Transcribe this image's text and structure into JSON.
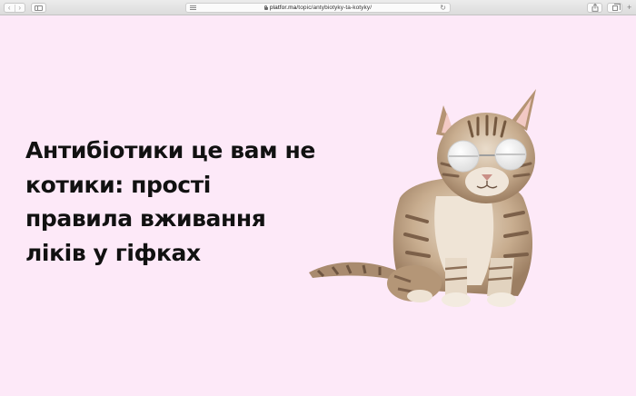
{
  "browser": {
    "url_domain": "platfor.ma",
    "url_path": "/topic/antybiotyky-ta-kotyky/",
    "icons": {
      "back": "chevron-left-icon",
      "forward": "chevron-right-icon",
      "sidebar": "sidebar-icon",
      "reader": "reader-icon",
      "lock": "lock-icon",
      "reload": "reload-icon",
      "share": "share-icon",
      "tabs": "tabs-icon",
      "new_tab": "plus-icon"
    }
  },
  "article": {
    "title_lines": [
      "Антибіотики це вам не",
      "котики: прості",
      "правила вживання",
      "ліків у гіфках"
    ]
  },
  "colors": {
    "page_background": "#fde9f8",
    "headline": "#111111"
  }
}
